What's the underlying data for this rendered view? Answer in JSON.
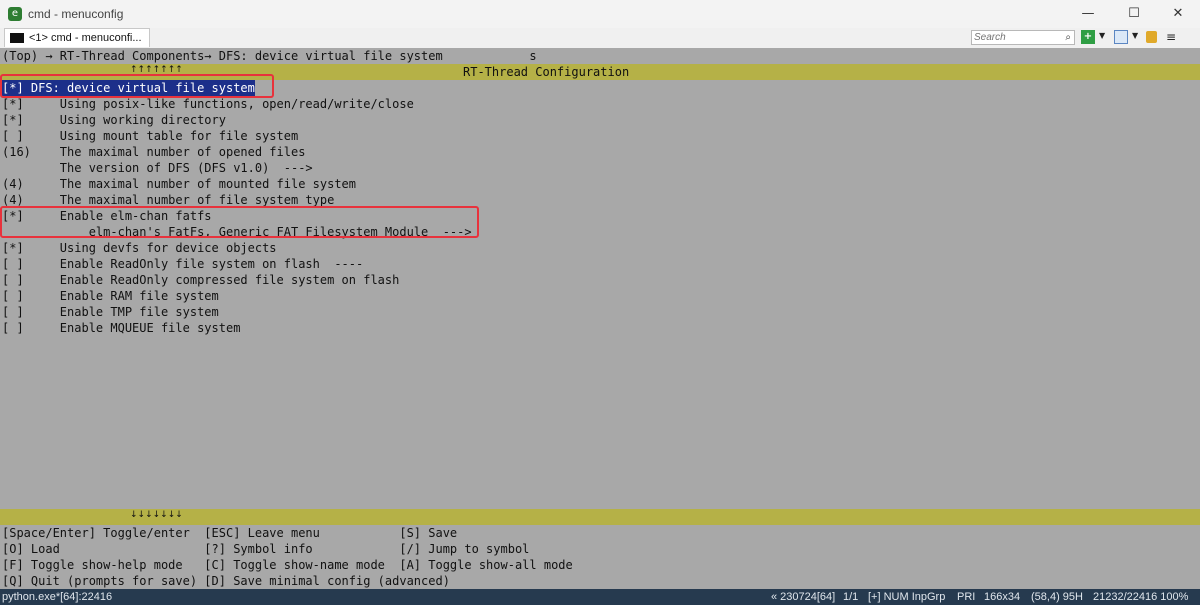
{
  "window": {
    "title": "cmd - menuconfig",
    "minimize_glyph": "—",
    "maximize_glyph": "☐",
    "close_glyph": "✕"
  },
  "tabs": [
    {
      "label": "<1> cmd - menuconfi..."
    }
  ],
  "search": {
    "placeholder": "Search",
    "icon": "search-icon"
  },
  "toolbar_icons": [
    "new-console-plus-icon",
    "layout-icon",
    "lock-icon",
    "menu-icon"
  ],
  "terminal": {
    "breadcrumb": "(Top) → RT-Thread Components→ DFS: device virtual file system            s",
    "up_arrows": "↑↑↑↑↑↑↑",
    "header_title": "RT-Thread Configuration",
    "menu_items": [
      "[*] DFS: device virtual file system",
      "[*]     Using posix-like functions, open/read/write/close",
      "[*]     Using working directory",
      "[ ]     Using mount table for file system",
      "(16)    The maximal number of opened files",
      "        The version of DFS (DFS v1.0)  --->",
      "(4)     The maximal number of mounted file system",
      "(4)     The maximal number of file system type",
      "[*]     Enable elm-chan fatfs",
      "            elm-chan's FatFs, Generic FAT Filesystem Module  --->",
      "[*]     Using devfs for device objects",
      "[ ]     Enable ReadOnly file system on flash  ----",
      "[ ]     Enable ReadOnly compressed file system on flash",
      "[ ]     Enable RAM file system",
      "[ ]     Enable TMP file system",
      "[ ]     Enable MQUEUE file system"
    ],
    "selected_index": 0,
    "down_arrows": "↓↓↓↓↓↓↓",
    "help_lines": [
      "[Space/Enter] Toggle/enter  [ESC] Leave menu           [S] Save",
      "[O] Load                    [?] Symbol info            [/] Jump to symbol",
      "[F] Toggle show-help mode   [C] Toggle show-name mode  [A] Toggle show-all mode",
      "[Q] Quit (prompts for save) [D] Save minimal config (advanced)"
    ],
    "colors": {
      "background": "#a8a8a8",
      "bar": "#b5b147",
      "selection": "#1c2f8a",
      "annotation": "#e8323c"
    }
  },
  "status": {
    "process": "python.exe*[64]:22416",
    "build": "« 230724[64]",
    "page": "1/1",
    "mode": "[+] NUM InpGrp",
    "priority": "PRI",
    "size": "166x34",
    "cursor": "(58,4) 95H",
    "pid_zoom": "21232/22416 100%"
  }
}
